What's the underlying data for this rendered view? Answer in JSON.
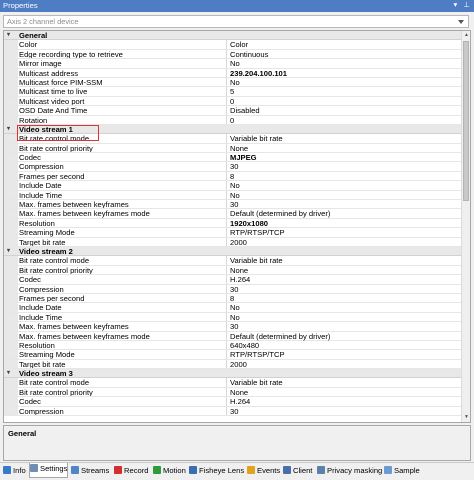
{
  "window": {
    "title": "Properties",
    "controls": [
      "▾",
      "⊥"
    ]
  },
  "device_select": {
    "value": "Axis 2 channel device"
  },
  "categories": [
    {
      "name": "General",
      "rows": [
        {
          "name": "Color",
          "value": "Color"
        },
        {
          "name": "Edge recording type to retrieve",
          "value": "Continuous"
        },
        {
          "name": "Mirror image",
          "value": "No"
        },
        {
          "name": "Multicast address",
          "value": "239.204.100.101",
          "bold": true
        },
        {
          "name": "Multicast force PIM-SSM",
          "value": "No"
        },
        {
          "name": "Multicast time to live",
          "value": "5"
        },
        {
          "name": "Multicast video port",
          "value": "0"
        },
        {
          "name": "OSD Date And Time",
          "value": "Disabled"
        },
        {
          "name": "Rotation",
          "value": "0"
        }
      ]
    },
    {
      "name": "Video stream 1",
      "rows": [
        {
          "name": "Bit rate control mode",
          "value": "Variable bit rate"
        },
        {
          "name": "Bit rate control priority",
          "value": "None"
        },
        {
          "name": "Codec",
          "value": "MJPEG",
          "bold": true
        },
        {
          "name": "Compression",
          "value": "30"
        },
        {
          "name": "Frames per second",
          "value": "8"
        },
        {
          "name": "Include Date",
          "value": "No"
        },
        {
          "name": "Include Time",
          "value": "No"
        },
        {
          "name": "Max. frames between keyframes",
          "value": "30"
        },
        {
          "name": "Max. frames between keyframes mode",
          "value": "Default (determined by driver)"
        },
        {
          "name": "Resolution",
          "value": "1920x1080",
          "bold": true
        },
        {
          "name": "Streaming Mode",
          "value": "RTP/RTSP/TCP"
        },
        {
          "name": "Target bit rate",
          "value": "2000"
        }
      ]
    },
    {
      "name": "Video stream 2",
      "rows": [
        {
          "name": "Bit rate control mode",
          "value": "Variable bit rate"
        },
        {
          "name": "Bit rate control priority",
          "value": "None"
        },
        {
          "name": "Codec",
          "value": "H.264"
        },
        {
          "name": "Compression",
          "value": "30"
        },
        {
          "name": "Frames per second",
          "value": "8"
        },
        {
          "name": "Include Date",
          "value": "No"
        },
        {
          "name": "Include Time",
          "value": "No"
        },
        {
          "name": "Max. frames between keyframes",
          "value": "30"
        },
        {
          "name": "Max. frames between keyframes mode",
          "value": "Default (determined by driver)"
        },
        {
          "name": "Resolution",
          "value": "640x480"
        },
        {
          "name": "Streaming Mode",
          "value": "RTP/RTSP/TCP"
        },
        {
          "name": "Target bit rate",
          "value": "2000"
        }
      ]
    },
    {
      "name": "Video stream 3",
      "rows": [
        {
          "name": "Bit rate control mode",
          "value": "Variable bit rate"
        },
        {
          "name": "Bit rate control priority",
          "value": "None"
        },
        {
          "name": "Codec",
          "value": "H.264"
        },
        {
          "name": "Compression",
          "value": "30"
        }
      ]
    }
  ],
  "description": {
    "title": "General"
  },
  "tabs": [
    {
      "label": "Info",
      "icon": "info-icon",
      "color": "#3a78c9"
    },
    {
      "label": "Settings",
      "icon": "settings-icon",
      "color": "#6f8db5",
      "active": true
    },
    {
      "label": "Streams",
      "icon": "streams-icon",
      "color": "#4f86c6"
    },
    {
      "label": "Record",
      "icon": "record-icon",
      "color": "#d32f2f"
    },
    {
      "label": "Motion",
      "icon": "motion-icon",
      "color": "#2e9b3a"
    },
    {
      "label": "Fisheye Lens",
      "icon": "fisheye-icon",
      "color": "#3b6db3"
    },
    {
      "label": "Events",
      "icon": "events-icon",
      "color": "#e0a31c"
    },
    {
      "label": "Client",
      "icon": "client-icon",
      "color": "#4a6ea8"
    },
    {
      "label": "Privacy masking",
      "icon": "privacy-icon",
      "color": "#5d7fa8"
    },
    {
      "label": "Sample",
      "icon": "sample-icon",
      "color": "#6b9bd1"
    }
  ]
}
